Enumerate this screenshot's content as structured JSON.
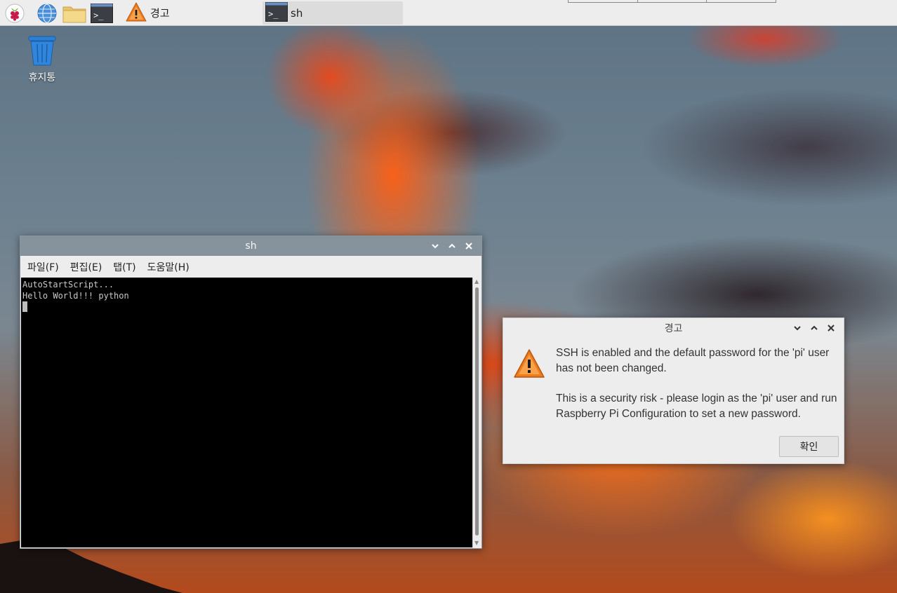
{
  "taskbar": {
    "launchers": [
      {
        "icon": "raspberry-menu-icon"
      },
      {
        "icon": "web-browser-icon"
      },
      {
        "icon": "file-manager-icon"
      },
      {
        "icon": "terminal-icon"
      }
    ],
    "tasks": [
      {
        "icon": "warning-icon",
        "label": "경고"
      },
      {
        "icon": "terminal-icon",
        "label": "sh"
      }
    ]
  },
  "desktop": {
    "trash": {
      "icon": "trash-icon",
      "label": "휴지통"
    }
  },
  "terminal_window": {
    "title": "sh",
    "menu": [
      "파일(F)",
      "편집(E)",
      "탭(T)",
      "도움말(H)"
    ],
    "lines": [
      "AutoStartScript...",
      "Hello World!!! python"
    ]
  },
  "warning_dialog": {
    "title": "경고",
    "message_line1": "SSH is enabled and the default password for the 'pi' user has not been changed.",
    "message_line2": "This is a security risk - please login as the 'pi' user and run Raspberry Pi Configuration to set a new password.",
    "ok_label": "확인"
  },
  "colors": {
    "terminal_titlebar": "#87939c",
    "terminal_background": "#000000",
    "dialog_background": "#ededed",
    "warning_orange": "#f07b1c"
  }
}
